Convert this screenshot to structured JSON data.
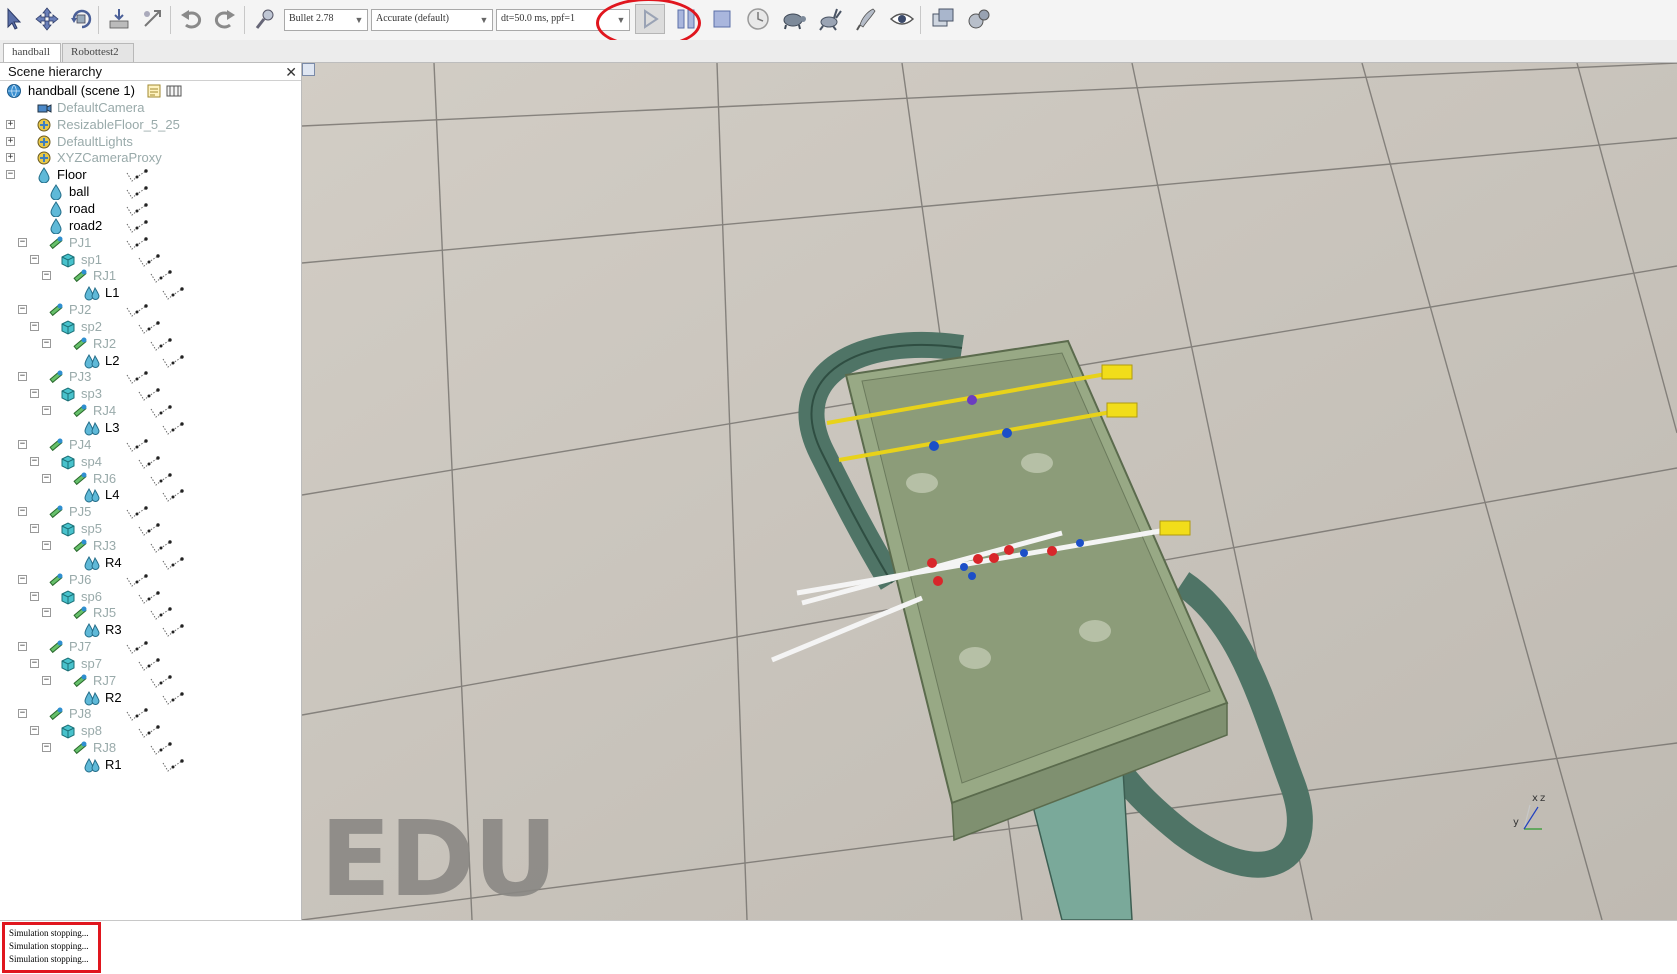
{
  "toolbar": {
    "engine_combo": "Bullet 2.78",
    "accuracy_combo": "Accurate (default)",
    "timestep_combo": "dt=50.0 ms, ppf=1",
    "icons": [
      "pointer-icon",
      "move-icon",
      "rotate-icon",
      "assemble-icon",
      "transfer-dna-icon",
      "undo-icon",
      "redo-icon",
      "engine-settings-icon",
      "play-icon",
      "pause-icon",
      "stop-icon",
      "realtime-icon",
      "slow-icon",
      "fast-icon",
      "thread-rendering-icon",
      "visualization-icon",
      "page-icon",
      "scene-icon"
    ],
    "highlight_color": "#e0161e"
  },
  "tabs": [
    {
      "label": "handball",
      "active": true
    },
    {
      "label": "Robottest2",
      "active": false
    }
  ],
  "hierarchy": {
    "title": "Scene hierarchy",
    "close_label": "✕",
    "root_label": "handball (scene 1)",
    "items": [
      {
        "label": "DefaultCamera",
        "type": "camera",
        "dim": true
      },
      {
        "label": "ResizableFloor_5_25",
        "type": "model",
        "dim": true
      },
      {
        "label": "DefaultLights",
        "type": "model",
        "dim": true
      },
      {
        "label": "XYZCameraProxy",
        "type": "model",
        "dim": true
      },
      {
        "label": "Floor",
        "type": "shape",
        "dim": false
      },
      {
        "label": "ball",
        "type": "shape",
        "dim": false
      },
      {
        "label": "road",
        "type": "shape",
        "dim": false
      },
      {
        "label": "road2",
        "type": "shape",
        "dim": false
      },
      {
        "label": "PJ1",
        "type": "joint",
        "dim": true
      },
      {
        "label": "sp1",
        "type": "cube",
        "dim": true
      },
      {
        "label": "RJ1",
        "type": "joint",
        "dim": true
      },
      {
        "label": "L1",
        "type": "multishape",
        "dim": false
      },
      {
        "label": "PJ2",
        "type": "joint",
        "dim": true
      },
      {
        "label": "sp2",
        "type": "cube",
        "dim": true
      },
      {
        "label": "RJ2",
        "type": "joint",
        "dim": true
      },
      {
        "label": "L2",
        "type": "multishape",
        "dim": false
      },
      {
        "label": "PJ3",
        "type": "joint",
        "dim": true
      },
      {
        "label": "sp3",
        "type": "cube",
        "dim": true
      },
      {
        "label": "RJ4",
        "type": "joint",
        "dim": true
      },
      {
        "label": "L3",
        "type": "multishape",
        "dim": false
      },
      {
        "label": "PJ4",
        "type": "joint",
        "dim": true
      },
      {
        "label": "sp4",
        "type": "cube",
        "dim": true
      },
      {
        "label": "RJ6",
        "type": "joint",
        "dim": true
      },
      {
        "label": "L4",
        "type": "multishape",
        "dim": false
      },
      {
        "label": "PJ5",
        "type": "joint",
        "dim": true
      },
      {
        "label": "sp5",
        "type": "cube",
        "dim": true
      },
      {
        "label": "RJ3",
        "type": "joint",
        "dim": true
      },
      {
        "label": "R4",
        "type": "multishape",
        "dim": false
      },
      {
        "label": "PJ6",
        "type": "joint",
        "dim": true
      },
      {
        "label": "sp6",
        "type": "cube",
        "dim": true
      },
      {
        "label": "RJ5",
        "type": "joint",
        "dim": true
      },
      {
        "label": "R3",
        "type": "multishape",
        "dim": false
      },
      {
        "label": "PJ7",
        "type": "joint",
        "dim": true
      },
      {
        "label": "sp7",
        "type": "cube",
        "dim": true
      },
      {
        "label": "RJ7",
        "type": "joint",
        "dim": true
      },
      {
        "label": "R2",
        "type": "multishape",
        "dim": false
      },
      {
        "label": "PJ8",
        "type": "joint",
        "dim": true
      },
      {
        "label": "sp8",
        "type": "cube",
        "dim": true
      },
      {
        "label": "RJ8",
        "type": "joint",
        "dim": true
      },
      {
        "label": "R1",
        "type": "multishape",
        "dim": false
      }
    ]
  },
  "viewport": {
    "watermark": "EDU",
    "axis_labels": {
      "x": "x",
      "y": "y",
      "z": "z"
    }
  },
  "console": {
    "lines": [
      "Simulation stopping...",
      "Simulation stopping...",
      "Simulation stopping..."
    ]
  }
}
